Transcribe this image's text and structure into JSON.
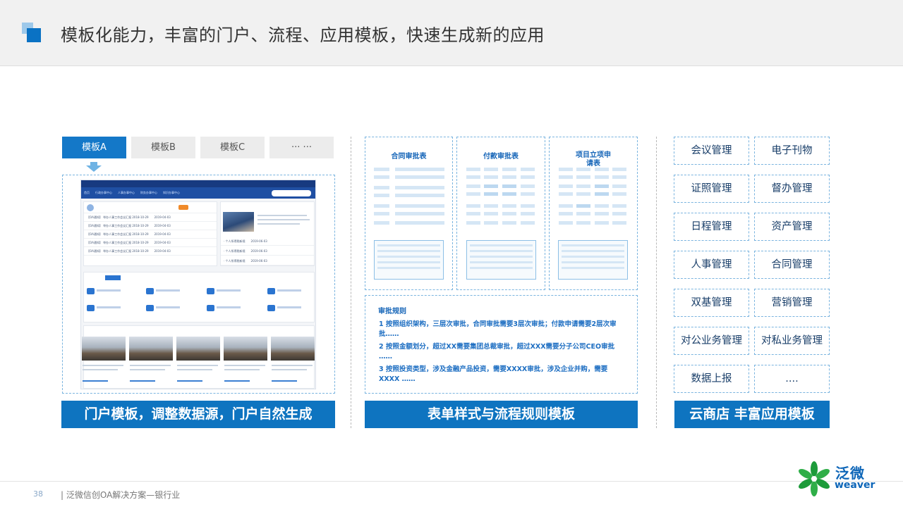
{
  "header": {
    "title": "模板化能力，丰富的门户、流程、应用模板，快速生成新的应用"
  },
  "tabs": [
    {
      "label": "模板A",
      "active": true
    },
    {
      "label": "模板B",
      "active": false
    },
    {
      "label": "模板C",
      "active": false
    },
    {
      "label": "··· ···",
      "active": false
    }
  ],
  "forms": [
    {
      "title": "合同审批表"
    },
    {
      "title": "付款审批表"
    },
    {
      "title": "项目立项申\n请表"
    }
  ],
  "rules": {
    "title": "审批规则",
    "items": [
      "1 按照组织架构，三层次审批，合同审批需要3层次审批；付款申请需要2层次审批……",
      "2 按照金额划分，超过XX需要集团总裁审批，超过XXX需要分子公司CEO审批 ……",
      "3 按照投资类型，涉及金融产品投资，需要XXXX审批，涉及企业并购，需要XXXX ……"
    ]
  },
  "apps": [
    [
      "会议管理",
      "电子刊物"
    ],
    [
      "证照管理",
      "督办管理"
    ],
    [
      "日程管理",
      "资产管理"
    ],
    [
      "人事管理",
      "合同管理"
    ],
    [
      "双基管理",
      "营销管理"
    ],
    [
      "对公业务管理",
      "对私业务管理"
    ],
    [
      "数据上报",
      "...."
    ]
  ],
  "banners": {
    "portal": "门户模板，调整数据源，门户自然生成",
    "form": "表单样式与流程规则模板",
    "store": "云商店 丰富应用模板"
  },
  "footer": {
    "page": "38",
    "text": "| 泛微信创OA解决方案—银行业"
  },
  "logo": {
    "cn": "泛微",
    "en": "weaver"
  },
  "colors": {
    "accent": "#0e74c0",
    "light_accent": "#9ec9ea",
    "text_blue": "#1d6ec2"
  }
}
